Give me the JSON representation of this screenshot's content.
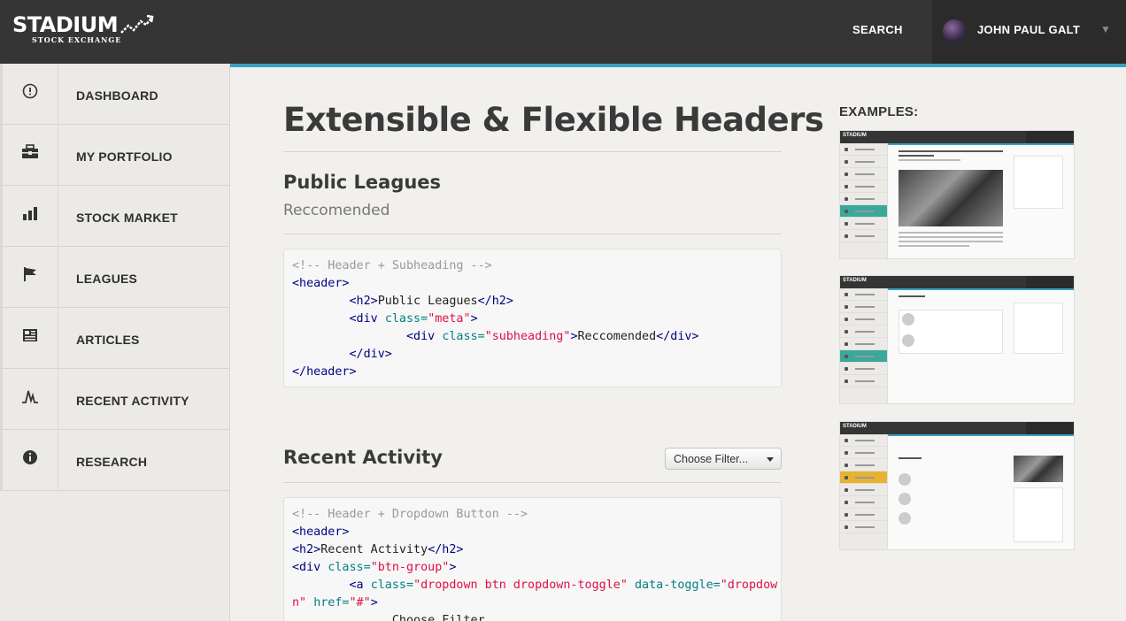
{
  "brand": {
    "name": "STADIUM",
    "tagline": "STOCK EXCHANGE"
  },
  "topbar": {
    "search_label": "SEARCH",
    "user_name": "JOHN PAUL GALT"
  },
  "sidebar": {
    "items": [
      {
        "label": "DASHBOARD",
        "icon": "dashboard-icon"
      },
      {
        "label": "MY PORTFOLIO",
        "icon": "briefcase-icon"
      },
      {
        "label": "STOCK MARKET",
        "icon": "bar-chart-icon"
      },
      {
        "label": "LEAGUES",
        "icon": "flag-icon"
      },
      {
        "label": "ARTICLES",
        "icon": "newspaper-icon"
      },
      {
        "label": "RECENT ACTIVITY",
        "icon": "activity-icon"
      },
      {
        "label": "RESEARCH",
        "icon": "info-icon"
      }
    ]
  },
  "main": {
    "title": "Extensible & Flexible Headers",
    "section1": {
      "title": "Public Leagues",
      "subheading": "Reccomended"
    },
    "section2": {
      "title": "Recent Activity",
      "filter_label": "Choose Filter..."
    }
  },
  "examples": {
    "title": "EXAMPLES:"
  },
  "colors": {
    "accent": "#3aa0c6",
    "topbar": "#353535",
    "sidebar": "#ebeae6",
    "teal": "#3aa89b",
    "yellow": "#e8b130"
  }
}
